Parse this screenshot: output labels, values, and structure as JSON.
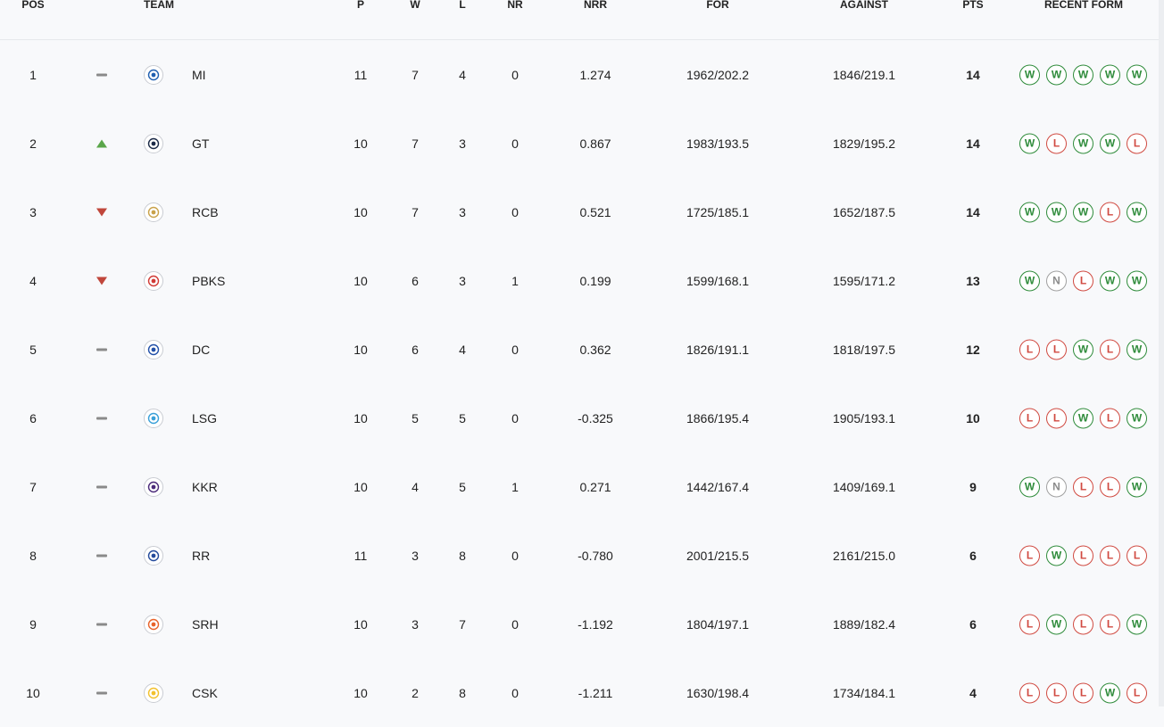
{
  "headers": {
    "pos": "POS",
    "team": "TEAM",
    "p": "P",
    "w": "W",
    "l": "L",
    "nr": "NR",
    "nrr": "NRR",
    "for": "FOR",
    "against": "AGAINST",
    "pts": "PTS",
    "form": "RECENT FORM"
  },
  "colors": {
    "win": "#2e8b3a",
    "loss": "#d04a41",
    "no_result": "#a0a0a0",
    "trend_up": "#5aa64a",
    "trend_down": "#c0463b",
    "trend_same": "#8a8a8a"
  },
  "rows": [
    {
      "pos": "1",
      "trend": "same",
      "logo_icon": "mi-logo-icon",
      "logo_color": "#1f5fb0",
      "team": "MI",
      "p": "11",
      "w": "7",
      "l": "4",
      "nr": "0",
      "nrr": "1.274",
      "for": "1962/202.2",
      "against": "1846/219.1",
      "pts": "14",
      "form": [
        "W",
        "W",
        "W",
        "W",
        "W"
      ]
    },
    {
      "pos": "2",
      "trend": "up",
      "logo_icon": "gt-logo-icon",
      "logo_color": "#1b2a47",
      "team": "GT",
      "p": "10",
      "w": "7",
      "l": "3",
      "nr": "0",
      "nrr": "0.867",
      "for": "1983/193.5",
      "against": "1829/195.2",
      "pts": "14",
      "form": [
        "W",
        "L",
        "W",
        "W",
        "L"
      ]
    },
    {
      "pos": "3",
      "trend": "down",
      "logo_icon": "rcb-logo-icon",
      "logo_color": "#c9a24a",
      "team": "RCB",
      "p": "10",
      "w": "7",
      "l": "3",
      "nr": "0",
      "nrr": "0.521",
      "for": "1725/185.1",
      "against": "1652/187.5",
      "pts": "14",
      "form": [
        "W",
        "W",
        "W",
        "L",
        "W"
      ]
    },
    {
      "pos": "4",
      "trend": "down",
      "logo_icon": "pbks-logo-icon",
      "logo_color": "#d13a35",
      "team": "PBKS",
      "p": "10",
      "w": "6",
      "l": "3",
      "nr": "1",
      "nrr": "0.199",
      "for": "1599/168.1",
      "against": "1595/171.2",
      "pts": "13",
      "form": [
        "W",
        "N",
        "L",
        "W",
        "W"
      ]
    },
    {
      "pos": "5",
      "trend": "same",
      "logo_icon": "dc-logo-icon",
      "logo_color": "#2250a8",
      "team": "DC",
      "p": "10",
      "w": "6",
      "l": "4",
      "nr": "0",
      "nrr": "0.362",
      "for": "1826/191.1",
      "against": "1818/197.5",
      "pts": "12",
      "form": [
        "L",
        "L",
        "W",
        "L",
        "W"
      ]
    },
    {
      "pos": "6",
      "trend": "same",
      "logo_icon": "lsg-logo-icon",
      "logo_color": "#3aa0d8",
      "team": "LSG",
      "p": "10",
      "w": "5",
      "l": "5",
      "nr": "0",
      "nrr": "-0.325",
      "for": "1866/195.4",
      "against": "1905/193.1",
      "pts": "10",
      "form": [
        "L",
        "L",
        "W",
        "L",
        "W"
      ]
    },
    {
      "pos": "7",
      "trend": "same",
      "logo_icon": "kkr-logo-icon",
      "logo_color": "#4b2a7a",
      "team": "KKR",
      "p": "10",
      "w": "4",
      "l": "5",
      "nr": "1",
      "nrr": "0.271",
      "for": "1442/167.4",
      "against": "1409/169.1",
      "pts": "9",
      "form": [
        "W",
        "N",
        "L",
        "L",
        "W"
      ]
    },
    {
      "pos": "8",
      "trend": "same",
      "logo_icon": "rr-logo-icon",
      "logo_color": "#234a9b",
      "team": "RR",
      "p": "11",
      "w": "3",
      "l": "8",
      "nr": "0",
      "nrr": "-0.780",
      "for": "2001/215.5",
      "against": "2161/215.0",
      "pts": "6",
      "form": [
        "L",
        "W",
        "L",
        "L",
        "L"
      ]
    },
    {
      "pos": "9",
      "trend": "same",
      "logo_icon": "srh-logo-icon",
      "logo_color": "#e8632b",
      "team": "SRH",
      "p": "10",
      "w": "3",
      "l": "7",
      "nr": "0",
      "nrr": "-1.192",
      "for": "1804/197.1",
      "against": "1889/182.4",
      "pts": "6",
      "form": [
        "L",
        "W",
        "L",
        "L",
        "W"
      ]
    },
    {
      "pos": "10",
      "trend": "same",
      "logo_icon": "csk-logo-icon",
      "logo_color": "#f2c12e",
      "team": "CSK",
      "p": "10",
      "w": "2",
      "l": "8",
      "nr": "0",
      "nrr": "-1.211",
      "for": "1630/198.4",
      "against": "1734/184.1",
      "pts": "4",
      "form": [
        "L",
        "L",
        "L",
        "W",
        "L"
      ]
    }
  ]
}
